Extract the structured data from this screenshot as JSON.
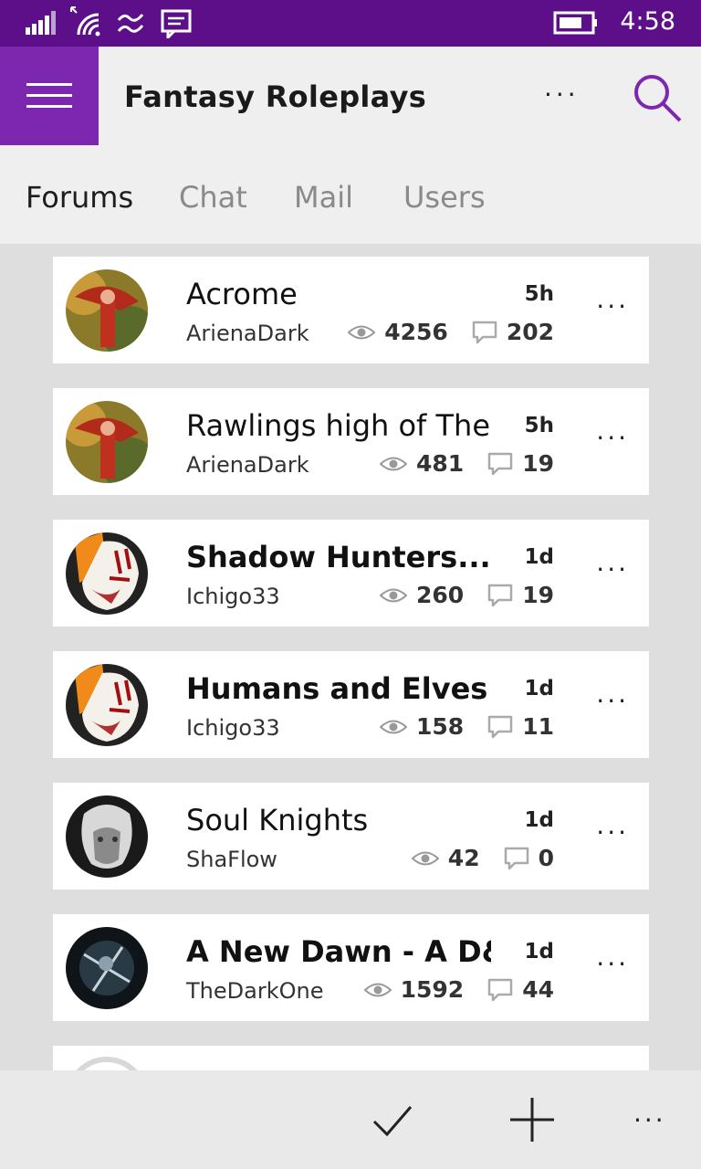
{
  "status_bar": {
    "time": "4:58",
    "icons": [
      "signal-icon",
      "wifi-icon",
      "sync-icon",
      "message-icon",
      "battery-icon"
    ]
  },
  "header": {
    "title": "Fantasy Roleplays",
    "more_label": "···"
  },
  "tabs": [
    {
      "label": "Forums",
      "active": true
    },
    {
      "label": "Chat",
      "active": false
    },
    {
      "label": "Mail",
      "active": false
    },
    {
      "label": "Users",
      "active": false
    }
  ],
  "topics": [
    {
      "title": "Acrome",
      "author": "ArienaDark",
      "age": "5h",
      "views": "4256",
      "replies": "202",
      "bold": false,
      "avatar": "red-warrior"
    },
    {
      "title": "Rawlings high of The",
      "author": "ArienaDark",
      "age": "5h",
      "views": "481",
      "replies": "19",
      "bold": false,
      "avatar": "red-warrior"
    },
    {
      "title": "Shadow Hunters.... (T",
      "author": "Ichigo33",
      "age": "1d",
      "views": "260",
      "replies": "19",
      "bold": true,
      "avatar": "hollow-mask"
    },
    {
      "title": "Humans and Elves (ro",
      "author": "Ichigo33",
      "age": "1d",
      "views": "158",
      "replies": "11",
      "bold": true,
      "avatar": "hollow-mask"
    },
    {
      "title": "Soul Knights",
      "author": "ShaFlow",
      "age": "1d",
      "views": "42",
      "replies": "0",
      "bold": false,
      "avatar": "white-hair"
    },
    {
      "title": "A New Dawn - A D&D",
      "author": "TheDarkOne",
      "age": "1d",
      "views": "1592",
      "replies": "44",
      "bold": true,
      "avatar": "dark-knight"
    }
  ],
  "card_more_label": "···",
  "bottom_bar": {
    "more_label": "···"
  },
  "colors": {
    "status_bar": "#5d0f8a",
    "accent": "#7d26b0",
    "background": "#dedede"
  }
}
